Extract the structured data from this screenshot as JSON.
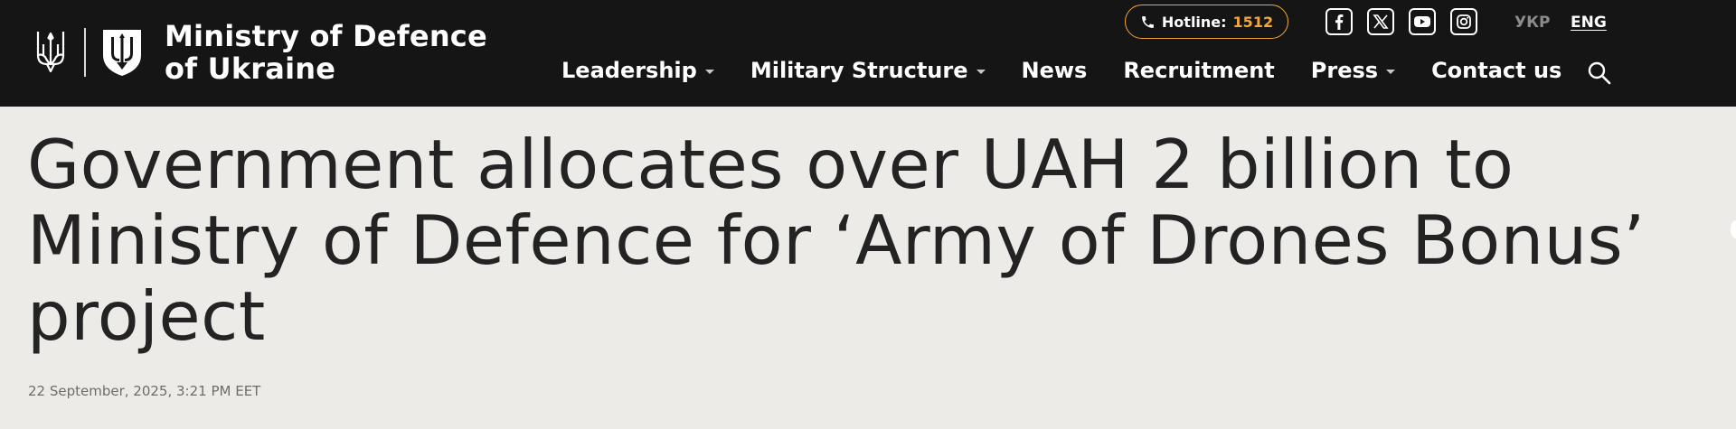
{
  "header": {
    "site_name_line1": "Ministry of Defence",
    "site_name_line2": "of Ukraine",
    "hotline_label": "Hotline:",
    "hotline_number": "1512",
    "accent_color": "#f0a83e",
    "background_color": "#151515"
  },
  "socials": [
    {
      "icon": "facebook-icon"
    },
    {
      "icon": "x-icon"
    },
    {
      "icon": "youtube-icon"
    },
    {
      "icon": "instagram-icon"
    }
  ],
  "languages": {
    "ukr": "УКР",
    "eng": "ENG",
    "active": "ENG"
  },
  "nav": {
    "items": [
      {
        "label": "Leadership",
        "has_dropdown": true
      },
      {
        "label": "Military Structure",
        "has_dropdown": true
      },
      {
        "label": "News",
        "has_dropdown": false
      },
      {
        "label": "Recruitment",
        "has_dropdown": false
      },
      {
        "label": "Press",
        "has_dropdown": true
      },
      {
        "label": "Contact us",
        "has_dropdown": false
      }
    ],
    "search_icon": "search-icon"
  },
  "article": {
    "title": "Government allocates over UAH 2 billion to Ministry of Defence for ‘Army of Drones Bonus’ project",
    "date": "22 September, 2025, 3:21 PM EET"
  }
}
